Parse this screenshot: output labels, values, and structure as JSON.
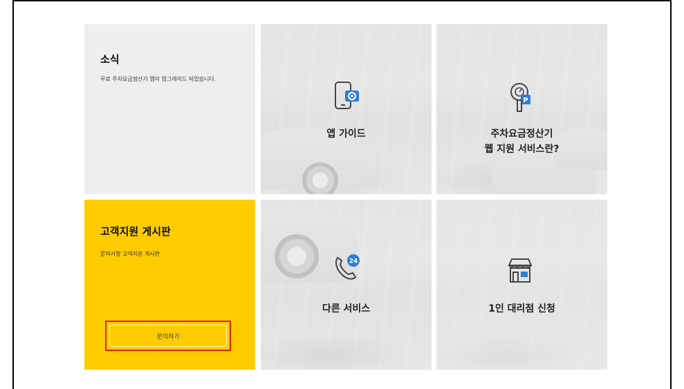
{
  "news": {
    "title": "소식",
    "description": "무료 주차요금정산기 앱이 업그레이드 되었습니다."
  },
  "app_guide": {
    "label": "앱 가이드",
    "icon": "phone-camera-icon"
  },
  "web_service": {
    "label_line1": "주차요금정산기",
    "label_line2": "웹 지원 서비스란?",
    "icon": "parking-meter-icon"
  },
  "support": {
    "title": "고객지원 게시판",
    "description": "문의사항 고객지원 게시판",
    "button_label": "문의하기"
  },
  "other_service": {
    "label": "다른 서비스",
    "icon": "phone-24-icon"
  },
  "agency": {
    "label": "1인 대리점 신청",
    "icon": "storefront-icon"
  },
  "colors": {
    "accent_yellow": "#fecc00",
    "icon_blue": "#2b7fd4",
    "highlight_red": "#e41b1b"
  }
}
